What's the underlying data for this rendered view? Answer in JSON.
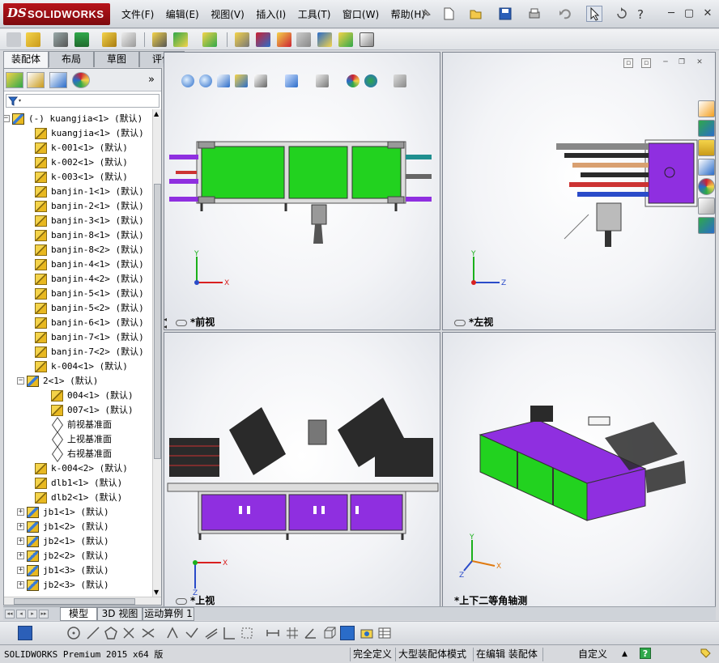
{
  "app": {
    "logo_ds": "DS",
    "logo_name": "SOLIDWORKS"
  },
  "menu": [
    "文件(F)",
    "编辑(E)",
    "视图(V)",
    "插入(I)",
    "工具(T)",
    "窗口(W)",
    "帮助(H)"
  ],
  "command_tabs": [
    "装配体",
    "布局",
    "草图",
    "评估"
  ],
  "filter": {
    "icon": "filter-icon"
  },
  "tree": [
    {
      "label": "(-) kuangjia<1> (默认)",
      "level": 0,
      "icon": "asm",
      "expander": "−"
    },
    {
      "label": "kuangjia<1> (默认)",
      "level": 2,
      "icon": "part"
    },
    {
      "label": "k-001<1> (默认)",
      "level": 2,
      "icon": "part"
    },
    {
      "label": "k-002<1> (默认)",
      "level": 2,
      "icon": "part"
    },
    {
      "label": "k-003<1> (默认)",
      "level": 2,
      "icon": "part"
    },
    {
      "label": "banjin-1<1> (默认)",
      "level": 2,
      "icon": "part"
    },
    {
      "label": "banjin-2<1> (默认)",
      "level": 2,
      "icon": "part"
    },
    {
      "label": "banjin-3<1> (默认)",
      "level": 2,
      "icon": "part"
    },
    {
      "label": "banjin-8<1> (默认)",
      "level": 2,
      "icon": "part"
    },
    {
      "label": "banjin-8<2> (默认)",
      "level": 2,
      "icon": "part"
    },
    {
      "label": "banjin-4<1> (默认)",
      "level": 2,
      "icon": "part"
    },
    {
      "label": "banjin-4<2> (默认)",
      "level": 2,
      "icon": "part"
    },
    {
      "label": "banjin-5<1> (默认)",
      "level": 2,
      "icon": "part"
    },
    {
      "label": "banjin-5<2> (默认)",
      "level": 2,
      "icon": "part"
    },
    {
      "label": "banjin-6<1> (默认)",
      "level": 2,
      "icon": "part"
    },
    {
      "label": "banjin-7<1> (默认)",
      "level": 2,
      "icon": "part"
    },
    {
      "label": "banjin-7<2> (默认)",
      "level": 2,
      "icon": "part"
    },
    {
      "label": "k-004<1> (默认)",
      "level": 2,
      "icon": "part"
    },
    {
      "label": "2<1> (默认)",
      "level": 1,
      "icon": "asm",
      "expander": "−"
    },
    {
      "label": "004<1> (默认)",
      "level": 3,
      "icon": "part"
    },
    {
      "label": "007<1> (默认)",
      "level": 3,
      "icon": "part"
    },
    {
      "label": "前视基准面",
      "level": 3,
      "icon": "plane"
    },
    {
      "label": "上视基准面",
      "level": 3,
      "icon": "plane"
    },
    {
      "label": "右视基准面",
      "level": 3,
      "icon": "plane"
    },
    {
      "label": "k-004<2> (默认)",
      "level": 2,
      "icon": "part"
    },
    {
      "label": "dlb1<1> (默认)",
      "level": 2,
      "icon": "part"
    },
    {
      "label": "dlb2<1> (默认)",
      "level": 2,
      "icon": "part"
    },
    {
      "label": "jb1<1> (默认)",
      "level": 1,
      "icon": "asm",
      "expander": "+"
    },
    {
      "label": "jb1<2> (默认)",
      "level": 1,
      "icon": "asm",
      "expander": "+"
    },
    {
      "label": "jb2<1> (默认)",
      "level": 1,
      "icon": "asm",
      "expander": "+"
    },
    {
      "label": "jb2<2> (默认)",
      "level": 1,
      "icon": "asm",
      "expander": "+"
    },
    {
      "label": "jb1<3> (默认)",
      "level": 1,
      "icon": "asm",
      "expander": "+"
    },
    {
      "label": "jb2<3> (默认)",
      "level": 1,
      "icon": "asm",
      "expander": "+"
    }
  ],
  "viewports": {
    "front": "*前视",
    "left": "*左视",
    "top": "*上视",
    "iso": "*上下二等角轴测"
  },
  "axes": {
    "x": "X",
    "y": "Y",
    "z": "Z"
  },
  "bottom_tabs": [
    "模型",
    "3D 视图",
    "运动算例 1"
  ],
  "status": {
    "product": "SOLIDWORKS Premium 2015 x64 版",
    "defined": "完全定义",
    "mode": "大型装配体模式",
    "editing": "在编辑 装配体",
    "custom": "自定义",
    "help": "?"
  },
  "colors": {
    "green": "#22d21f",
    "purple": "#8f2fe0",
    "frame": "#7f8590",
    "dark": "#2a2a2a"
  }
}
